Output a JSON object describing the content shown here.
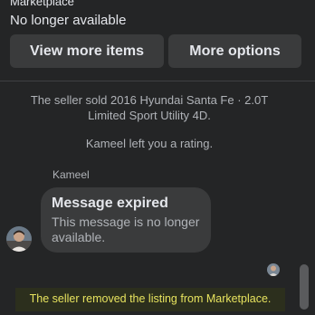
{
  "header": {
    "category": "Marketplace",
    "status": "No longer available",
    "buttons": {
      "view_more": "View more items",
      "more_options": "More options"
    }
  },
  "thread": {
    "sold_notice": "The seller sold 2016 Hyundai Santa Fe · 2.0T Limited Sport Utility 4D.",
    "rating_notice": "Kameel left you a rating.",
    "sender_name": "Kameel",
    "message": {
      "title": "Message expired",
      "body": "This message is no longer available."
    },
    "removed_notice": "The seller removed the listing from Marketplace."
  },
  "colors": {
    "background": "#242526",
    "button_bg": "#3a3b3c",
    "highlight_text": "#e7e35e"
  }
}
